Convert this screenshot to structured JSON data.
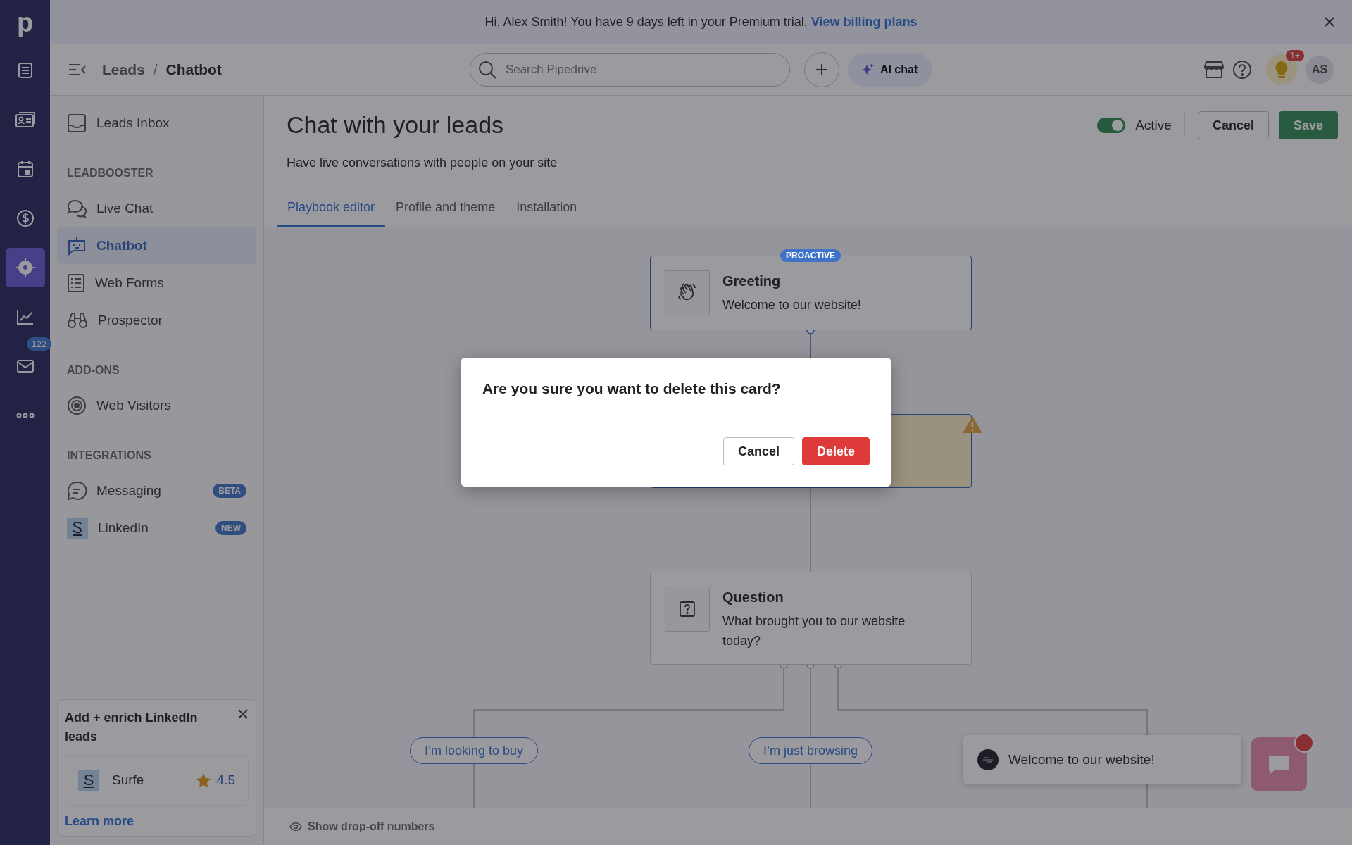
{
  "rail": {
    "logo": "p",
    "items": [
      {
        "selected": false
      },
      {
        "selected": false
      },
      {
        "selected": false
      },
      {
        "selected": false
      },
      {
        "selected": true
      },
      {
        "selected": false
      },
      {
        "selected": false,
        "badge": "122"
      },
      {
        "selected": false
      }
    ]
  },
  "banner": {
    "text": "Hi, Alex Smith! You have 9 days left in your Premium trial.",
    "link": "View billing plans"
  },
  "header": {
    "breadcrumb": [
      "Leads",
      "Chatbot"
    ],
    "separator": "/",
    "search": {
      "placeholder": "Search Pipedrive"
    },
    "ai_chat": "AI chat",
    "notification_badge": "1+",
    "avatar": "AS"
  },
  "sidebar": {
    "top_item": {
      "label": "Leads Inbox",
      "selected": false
    },
    "sections": [
      {
        "title": "LEADBOOSTER",
        "items": [
          {
            "label": "Live Chat",
            "selected": false
          },
          {
            "label": "Chatbot",
            "selected": true
          },
          {
            "label": "Web Forms",
            "selected": false
          },
          {
            "label": "Prospector",
            "selected": false
          }
        ]
      },
      {
        "title": "ADD-ONS",
        "items": [
          {
            "label": "Web Visitors",
            "selected": false
          }
        ]
      },
      {
        "title": "INTEGRATIONS",
        "items": [
          {
            "label": "Messaging",
            "selected": false,
            "badge": "BETA"
          },
          {
            "label": "LinkedIn",
            "selected": false,
            "badge": "NEW"
          }
        ]
      }
    ],
    "promo": {
      "title": "Add + enrich LinkedIn leads",
      "app": {
        "logo": "S",
        "name": "Surfe",
        "rating": "4.5"
      },
      "link": "Learn more"
    }
  },
  "page": {
    "title": "Chat with your leads",
    "subtitle": "Have live conversations with people on your site",
    "toggle": {
      "label": "Active",
      "on": true
    },
    "buttons": [
      "Cancel",
      "Save"
    ]
  },
  "tabs": [
    {
      "label": "Playbook editor",
      "selected": true
    },
    {
      "label": "Profile and theme",
      "selected": false
    },
    {
      "label": "Installation",
      "selected": false
    }
  ],
  "canvas": {
    "greeting": {
      "badge": "PROACTIVE",
      "title": "Greeting",
      "text": "Welcome to our website!"
    },
    "warning_card": {
      "warning": true
    },
    "question": {
      "title": "Question",
      "text": "What brought you to our website today?"
    },
    "replies": [
      "I’m looking to buy",
      "I’m just browsing"
    ]
  },
  "footer": {
    "text": "Show drop-off numbers"
  },
  "chat_widget": {
    "message": "Welcome to our website!",
    "unread": true
  },
  "dialog": {
    "text": "Are you sure you want to delete this card?",
    "buttons": [
      "Cancel",
      "Delete"
    ]
  }
}
